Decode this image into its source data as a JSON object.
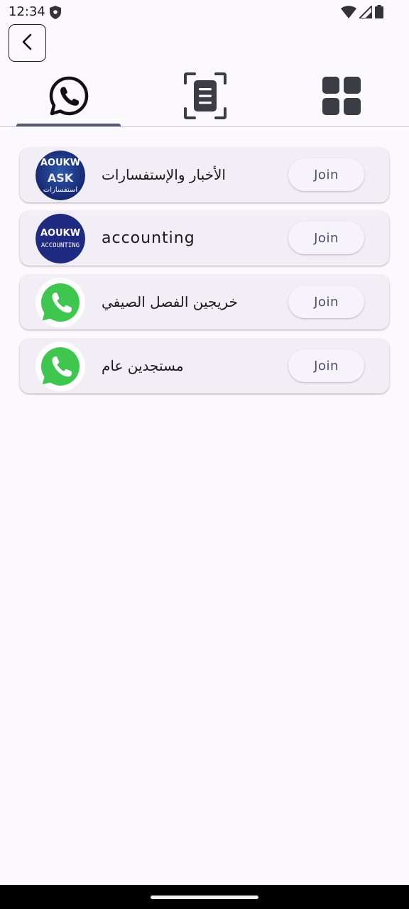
{
  "status_bar": {
    "time": "12:34"
  },
  "tabs": [
    {
      "icon": "whatsapp-icon",
      "selected": true
    },
    {
      "icon": "document-scan-icon",
      "selected": false
    },
    {
      "icon": "grid-icon",
      "selected": false
    }
  ],
  "groups": [
    {
      "name": "الأخبار والإستفسارات",
      "avatar": "aoukw-ask-logo",
      "avatar_top": "AOUKW",
      "avatar_mid": "ASK",
      "avatar_bottom": "استفسارات",
      "join_label": "Join"
    },
    {
      "name": "accounting",
      "avatar": "aoukw-accounting-logo",
      "avatar_top": "AOUKW",
      "avatar_mid": "ACCOUNTING",
      "join_label": "Join"
    },
    {
      "name": "خريجين الفصل الصيفي",
      "avatar": "whatsapp-logo",
      "join_label": "Join"
    },
    {
      "name": "مستجدين عام",
      "avatar": "whatsapp-logo",
      "join_label": "Join"
    }
  ],
  "colors": {
    "background": "#fbf8fe",
    "card": "#f1eff5",
    "tab_indicator": "#565a78",
    "join_text": "#4a4e6a",
    "whatsapp_green": "#3ec64f",
    "logo_navy": "#1f2b80"
  }
}
